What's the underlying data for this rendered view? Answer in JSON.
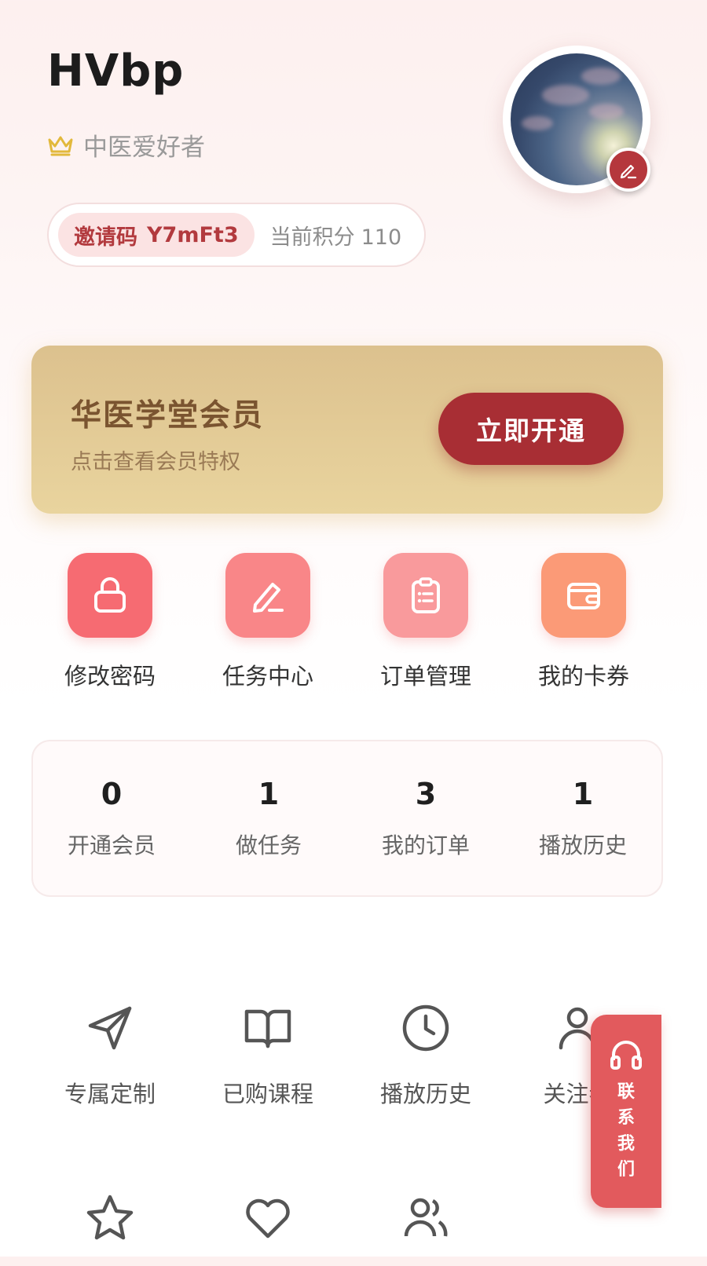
{
  "profile": {
    "username": "HVbp",
    "level": "中医爱好者",
    "invite_label": "邀请码",
    "invite_code": "Y7mFt3",
    "points_label": "当前积分",
    "points_value": "110"
  },
  "membership": {
    "title": "华医学堂会员",
    "subtitle": "点击查看会员特权",
    "button": "立即开通"
  },
  "quick_actions": [
    {
      "label": "修改密码",
      "icon": "lock-icon",
      "color": "#f66b72"
    },
    {
      "label": "任务中心",
      "icon": "pencil-icon",
      "color": "#f98688"
    },
    {
      "label": "订单管理",
      "icon": "clipboard-icon",
      "color": "#f99a9c"
    },
    {
      "label": "我的卡券",
      "icon": "wallet-icon",
      "color": "#fb9a77"
    }
  ],
  "stats": [
    {
      "value": "0",
      "label": "开通会员"
    },
    {
      "value": "1",
      "label": "做任务"
    },
    {
      "value": "3",
      "label": "我的订单"
    },
    {
      "value": "1",
      "label": "播放历史"
    }
  ],
  "menu": [
    {
      "label": "专属定制",
      "icon": "send-icon"
    },
    {
      "label": "已购课程",
      "icon": "book-icon"
    },
    {
      "label": "播放历史",
      "icon": "clock-icon"
    },
    {
      "label": "关注者",
      "icon": "user-icon"
    },
    {
      "label": "",
      "icon": "star-icon"
    },
    {
      "label": "",
      "icon": "heart-icon"
    },
    {
      "label": "",
      "icon": "users-icon"
    }
  ],
  "contact": {
    "label": "联系我们",
    "icon": "headset-icon"
  },
  "colors": {
    "brand_red": "#a82e34",
    "gold": "#e2cb96",
    "contact": "#e25a5d"
  }
}
